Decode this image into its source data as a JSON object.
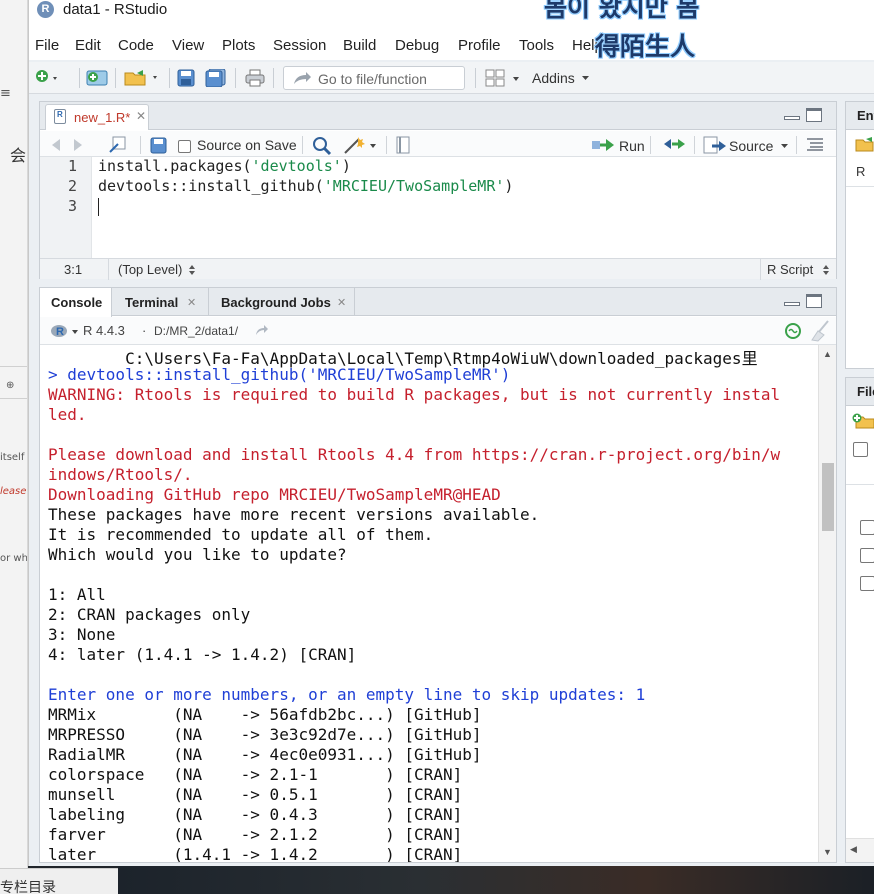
{
  "window": {
    "title": "data1 - RStudio",
    "overlay_text_1": "봄이 왔지만 봄",
    "overlay_text_2": "得陌生人"
  },
  "menu": [
    "File",
    "Edit",
    "Code",
    "View",
    "Plots",
    "Session",
    "Build",
    "Debug",
    "Profile",
    "Tools",
    "Help"
  ],
  "toolbar": {
    "goto_placeholder": "Go to file/function",
    "addins_label": "Addins"
  },
  "source": {
    "tab_label": "new_1.R*",
    "source_on_save_label": "Source on Save",
    "run_label": "Run",
    "source_label": "Source",
    "line_numbers": [
      "1",
      "2",
      "3"
    ],
    "lines": [
      {
        "fn": "install.packages(",
        "str": "'devtools'",
        "end": ")"
      },
      {
        "fn": "devtools::install_github(",
        "str": "'MRCIEU/TwoSampleMR'",
        "end": ")"
      },
      {
        "fn": "",
        "str": "",
        "end": ""
      }
    ],
    "cursor_pos": "3:1",
    "scope": "(Top Level)",
    "file_type": "R Script"
  },
  "console": {
    "tabs": [
      "Console",
      "Terminal",
      "Background Jobs"
    ],
    "r_version": "R 4.4.3",
    "working_dir": "D:/MR_2/data1/",
    "lines": [
      {
        "text": "        C:\\Users\\Fa-Fa\\AppData\\Local\\Temp\\Rtmp4oWiuW\\downloaded_packages里",
        "style": "normal"
      },
      {
        "text": "> devtools::install_github('MRCIEU/TwoSampleMR')",
        "style": "blue"
      },
      {
        "text": "WARNING: Rtools is required to build R packages, but is not currently instal",
        "style": "red"
      },
      {
        "text": "led.",
        "style": "red"
      },
      {
        "text": "",
        "style": "normal"
      },
      {
        "text": "Please download and install Rtools 4.4 from https://cran.r-project.org/bin/w",
        "style": "red"
      },
      {
        "text": "indows/Rtools/.",
        "style": "red"
      },
      {
        "text": "Downloading GitHub repo MRCIEU/TwoSampleMR@HEAD",
        "style": "red"
      },
      {
        "text": "These packages have more recent versions available.",
        "style": "normal"
      },
      {
        "text": "It is recommended to update all of them.",
        "style": "normal"
      },
      {
        "text": "Which would you like to update?",
        "style": "normal"
      },
      {
        "text": "",
        "style": "normal"
      },
      {
        "text": "1: All",
        "style": "normal"
      },
      {
        "text": "2: CRAN packages only",
        "style": "normal"
      },
      {
        "text": "3: None",
        "style": "normal"
      },
      {
        "text": "4: later (1.4.1 -> 1.4.2) [CRAN]",
        "style": "normal"
      },
      {
        "text": "",
        "style": "normal"
      },
      {
        "text": "Enter one or more numbers, or an empty line to skip updates: 1",
        "style": "blue"
      },
      {
        "text": "MRMix        (NA    -> 56afdb2bc...) [GitHub]",
        "style": "normal"
      },
      {
        "text": "MRPRESSO     (NA    -> 3e3c92d7e...) [GitHub]",
        "style": "normal"
      },
      {
        "text": "RadialMR     (NA    -> 4ec0e0931...) [GitHub]",
        "style": "normal"
      },
      {
        "text": "colorspace   (NA    -> 2.1-1       ) [CRAN]",
        "style": "normal"
      },
      {
        "text": "munsell      (NA    -> 0.5.1       ) [CRAN]",
        "style": "normal"
      },
      {
        "text": "labeling     (NA    -> 0.4.3       ) [CRAN]",
        "style": "normal"
      },
      {
        "text": "farver       (NA    -> 2.1.2       ) [CRAN]",
        "style": "normal"
      },
      {
        "text": "later        (1.4.1 -> 1.4.2       ) [CRAN]",
        "style": "normal"
      }
    ]
  },
  "right_panes": {
    "env_title": "Env",
    "files_title": "File",
    "r_label": "R"
  },
  "background": {
    "left_glyphs": [
      "会",
      "≡",
      "⊕"
    ],
    "left_snippets": [
      "itself a",
      "lease",
      "or wh"
    ],
    "taskbar_text": "专栏目录"
  },
  "colors": {
    "accent": "#2c68b0",
    "error": "#c5202d",
    "prompt": "#1f3fd6",
    "string": "#1a8a4a"
  }
}
